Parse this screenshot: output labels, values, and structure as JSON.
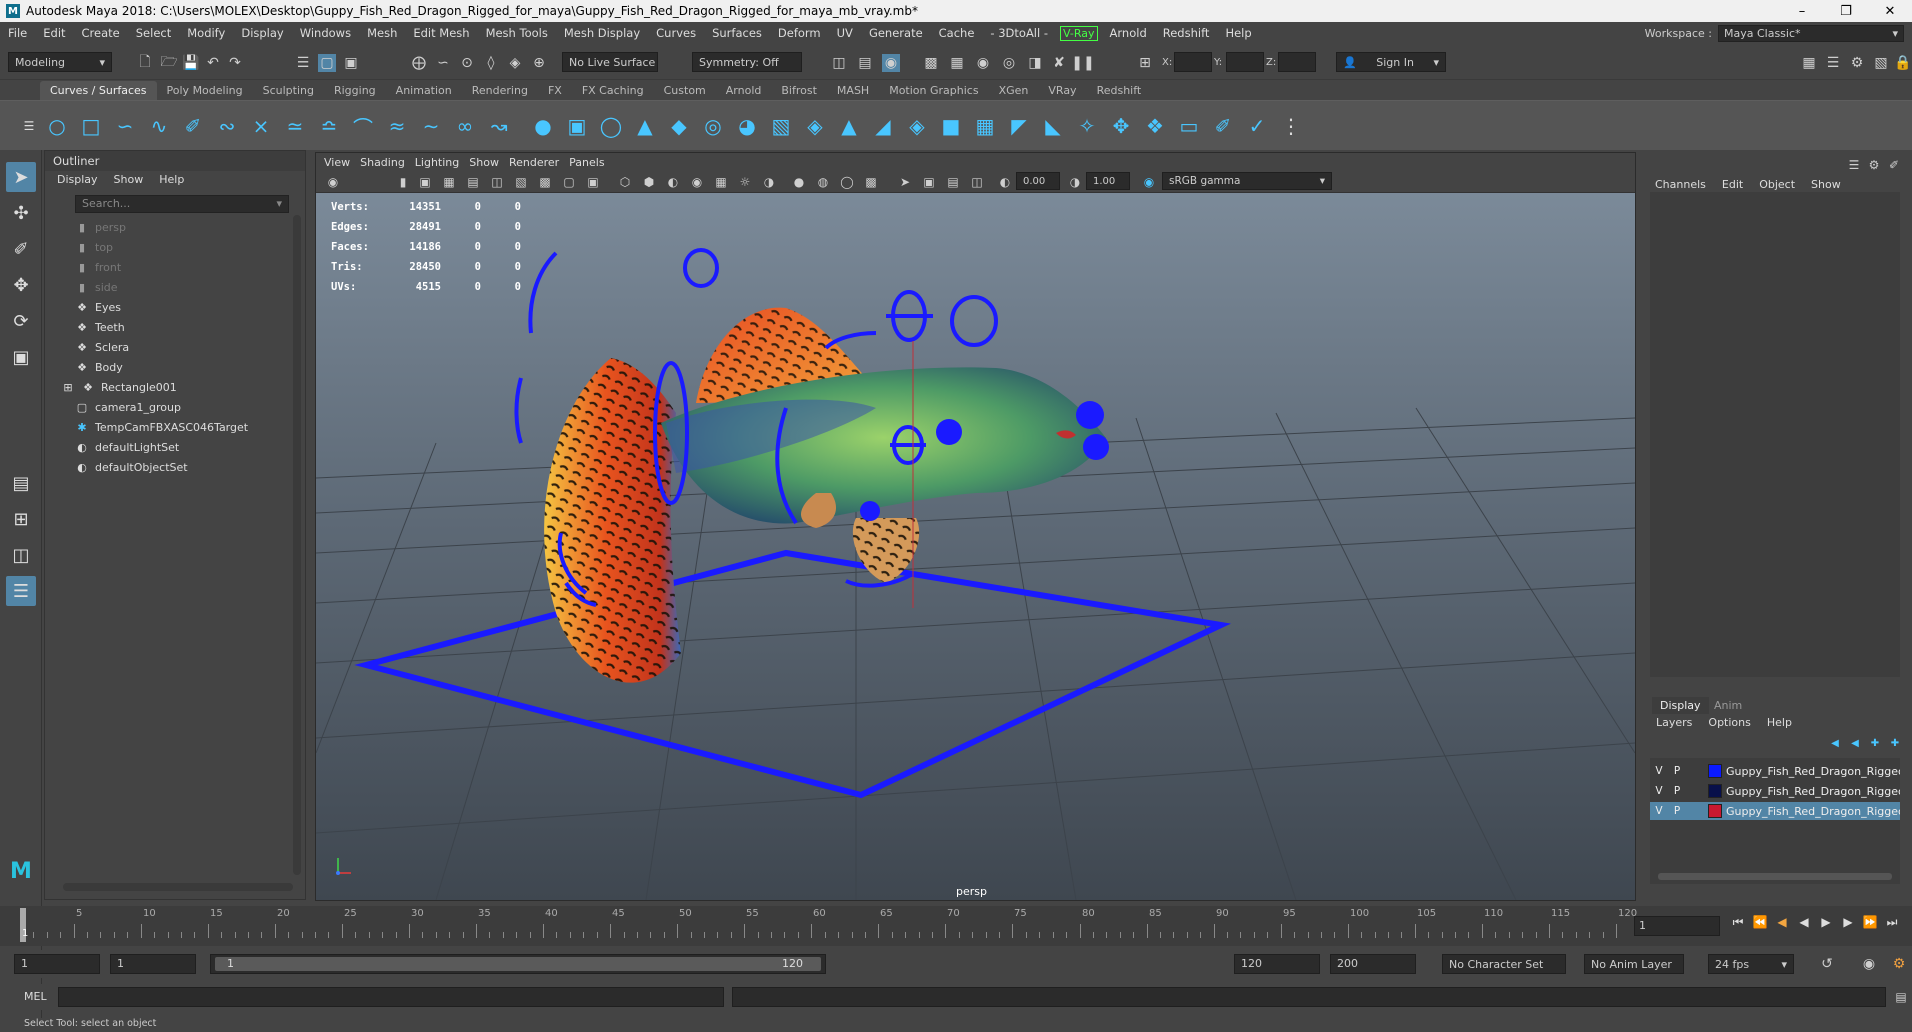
{
  "window": {
    "title": "Autodesk Maya 2018: C:\\Users\\MOLEX\\Desktop\\Guppy_Fish_Red_Dragon_Rigged_for_maya\\Guppy_Fish_Red_Dragon_Rigged_for_maya_mb_vray.mb*",
    "logo": "M"
  },
  "menubar": {
    "items": [
      "File",
      "Edit",
      "Create",
      "Select",
      "Modify",
      "Display",
      "Windows",
      "Mesh",
      "Edit Mesh",
      "Mesh Tools",
      "Mesh Display",
      "Curves",
      "Surfaces",
      "Deform",
      "UV",
      "Generate",
      "Cache",
      "- 3DtoAll -"
    ],
    "vray": "V-Ray",
    "items_after": [
      "Arnold",
      "Redshift",
      "Help"
    ],
    "workspace_label": "Workspace :",
    "workspace_value": "Maya Classic*"
  },
  "statusline": {
    "mode": "Modeling",
    "live_surface": "No Live Surface",
    "symmetry": "Symmetry: Off",
    "x_label": "X:",
    "y_label": "Y:",
    "z_label": "Z:",
    "sign_in": "Sign In"
  },
  "shelf_tabs": [
    "Curves / Surfaces",
    "Poly Modeling",
    "Sculpting",
    "Rigging",
    "Animation",
    "Rendering",
    "FX",
    "FX Caching",
    "Custom",
    "Arnold",
    "Bifrost",
    "MASH",
    "Motion Graphics",
    "XGen",
    "VRay",
    "Redshift"
  ],
  "outliner": {
    "title": "Outliner",
    "menu": [
      "Display",
      "Show",
      "Help"
    ],
    "search_placeholder": "Search...",
    "items": [
      {
        "label": "persp",
        "dim": true,
        "icon": "camera-icon"
      },
      {
        "label": "top",
        "dim": true,
        "icon": "camera-icon"
      },
      {
        "label": "front",
        "dim": true,
        "icon": "camera-icon"
      },
      {
        "label": "side",
        "dim": true,
        "icon": "camera-icon"
      },
      {
        "label": "Eyes",
        "dim": false,
        "icon": "mesh-icon"
      },
      {
        "label": "Teeth",
        "dim": false,
        "icon": "mesh-icon"
      },
      {
        "label": "Sclera",
        "dim": false,
        "icon": "mesh-icon"
      },
      {
        "label": "Body",
        "dim": false,
        "icon": "mesh-icon"
      },
      {
        "label": "Rectangle001",
        "dim": false,
        "icon": "mesh-icon",
        "expandable": true
      },
      {
        "label": "camera1_group",
        "dim": false,
        "icon": "group-icon"
      },
      {
        "label": "TempCamFBXASC046Target",
        "dim": false,
        "icon": "locator-icon"
      },
      {
        "label": "defaultLightSet",
        "dim": false,
        "icon": "set-icon"
      },
      {
        "label": "defaultObjectSet",
        "dim": false,
        "icon": "set-icon"
      }
    ]
  },
  "viewport": {
    "menu": [
      "View",
      "Shading",
      "Lighting",
      "Show",
      "Renderer",
      "Panels"
    ],
    "near_value": "0.00",
    "far_value": "1.00",
    "color_space": "sRGB gamma",
    "hud": [
      {
        "label": "Verts:",
        "v1": "14351",
        "v2": "0",
        "v3": "0"
      },
      {
        "label": "Edges:",
        "v1": "28491",
        "v2": "0",
        "v3": "0"
      },
      {
        "label": "Faces:",
        "v1": "14186",
        "v2": "0",
        "v3": "0"
      },
      {
        "label": "Tris:",
        "v1": "28450",
        "v2": "0",
        "v3": "0"
      },
      {
        "label": "UVs:",
        "v1": "4515",
        "v2": "0",
        "v3": "0"
      }
    ],
    "camera": "persp"
  },
  "channelbox": {
    "menu": [
      "Channels",
      "Edit",
      "Object",
      "Show"
    ],
    "layer_tabs": [
      "Display",
      "Anim"
    ],
    "layer_menu": [
      "Layers",
      "Options",
      "Help"
    ],
    "layers": [
      {
        "v": "V",
        "p": "P",
        "color": "#0a1aff",
        "name": "Guppy_Fish_Red_Dragon_Rigged",
        "selected": false
      },
      {
        "v": "V",
        "p": "P",
        "color": "#08104a",
        "name": "Guppy_Fish_Red_Dragon_Rigged",
        "selected": false
      },
      {
        "v": "V",
        "p": "P",
        "color": "#c81830",
        "name": "Guppy_Fish_Red_Dragon_Rigged",
        "selected": true
      }
    ]
  },
  "timeline": {
    "ticks": [
      "5",
      "10",
      "15",
      "20",
      "25",
      "30",
      "35",
      "40",
      "45",
      "50",
      "55",
      "60",
      "65",
      "70",
      "75",
      "80",
      "85",
      "90",
      "95",
      "100",
      "105",
      "110",
      "115",
      "120"
    ],
    "current_frame": "1",
    "frame_field": "1"
  },
  "range": {
    "start": "1",
    "start2": "1",
    "slider_start": "1",
    "slider_end": "120",
    "end": "120",
    "end2": "200",
    "character_set": "No Character Set",
    "anim_layer": "No Anim Layer",
    "fps": "24 fps"
  },
  "cmdline": {
    "label": "MEL"
  },
  "helpline": {
    "text": "Select Tool: select an object"
  },
  "colors": {
    "accent": "#5285a6",
    "rig_blue": "#1a1aff",
    "shelf_icon": "#49c6ff"
  }
}
